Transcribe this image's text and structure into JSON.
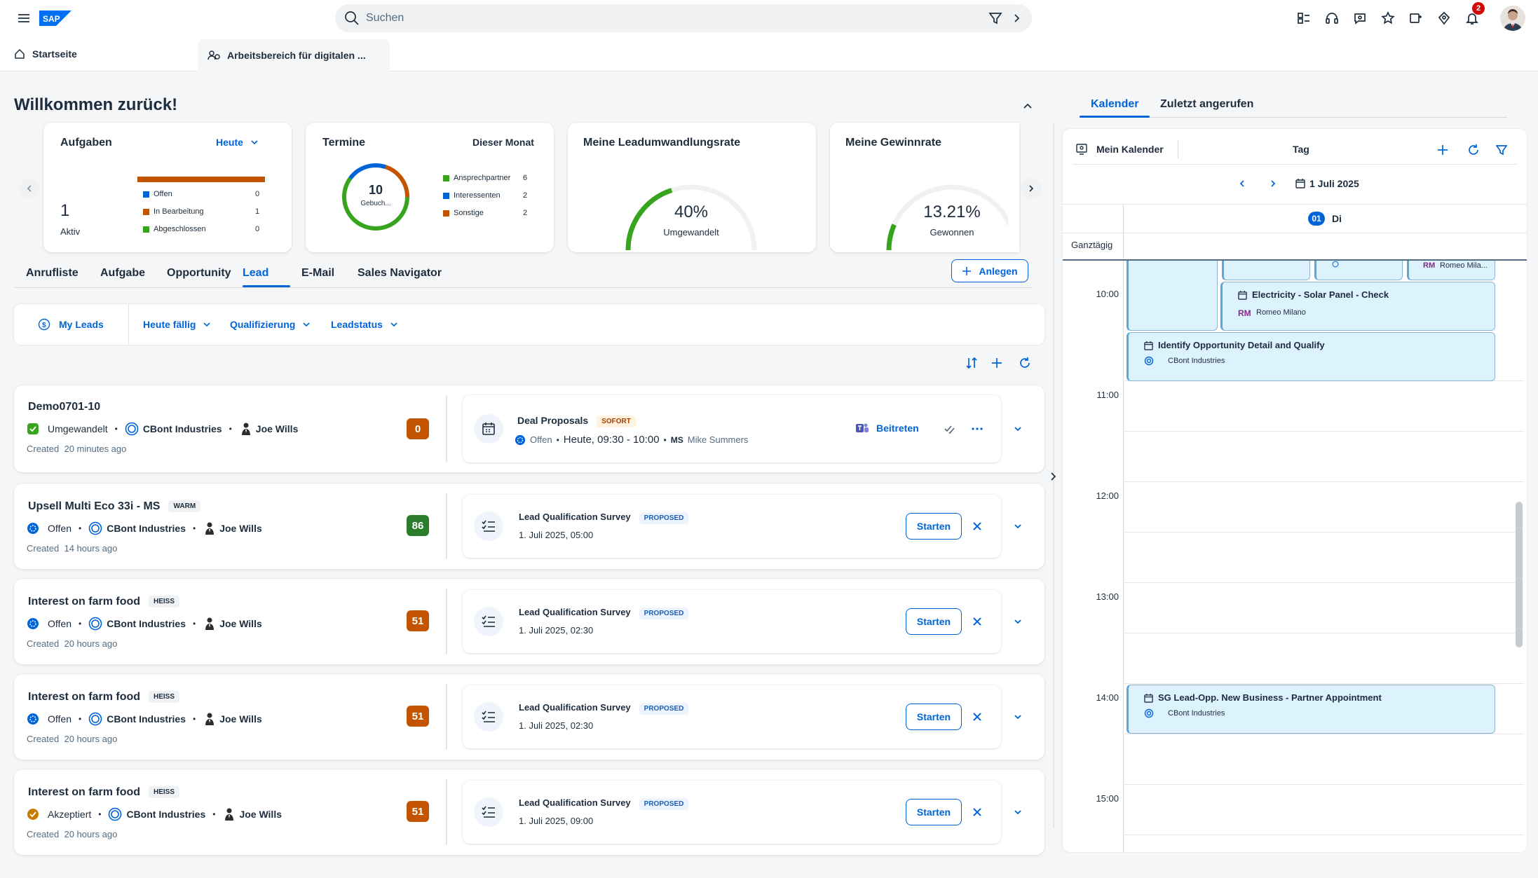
{
  "shell": {
    "logo": "SAP",
    "search_placeholder": "Suchen",
    "notification_count": "2"
  },
  "tabs": [
    {
      "label": "Startseite"
    },
    {
      "label": "Arbeitsbereich für digitalen ..."
    }
  ],
  "welcome": "Willkommen zurück!",
  "cards": {
    "aufgaben": {
      "title": "Aufgaben",
      "period": "Heute",
      "count": "1",
      "count_label": "Aktiv",
      "legend": [
        {
          "label": "Offen",
          "value": "0",
          "color": "#0064d9"
        },
        {
          "label": "In Bearbeitung",
          "value": "1",
          "color": "#c35500"
        },
        {
          "label": "Abgeschlossen",
          "value": "0",
          "color": "#36a41d"
        }
      ]
    },
    "termine": {
      "title": "Termine",
      "period": "Dieser Monat",
      "total": "10",
      "total_label": "Gebuch...",
      "legend": [
        {
          "label": "Ansprechpartner",
          "value": "6",
          "color": "#36a41d"
        },
        {
          "label": "Interessenten",
          "value": "2",
          "color": "#0064d9"
        },
        {
          "label": "Sonstige",
          "value": "2",
          "color": "#c35500"
        }
      ]
    },
    "leadrate": {
      "title": "Meine Leadumwandlungsrate",
      "value": "40%",
      "label": "Umgewandelt",
      "fraction": 0.4
    },
    "winrate": {
      "title": "Meine Gewinnrate",
      "value": "13.21%",
      "label": "Gewonnen",
      "fraction": 0.1321
    }
  },
  "nav_tabs": [
    "Anrufliste",
    "Aufgabe",
    "Opportunity",
    "Lead",
    "E-Mail",
    "Sales Navigator"
  ],
  "create_label": "Anlegen",
  "filters": {
    "my_leads": "My Leads",
    "items": [
      "Heute fällig",
      "Qualifizierung",
      "Leadstatus"
    ]
  },
  "leads": [
    {
      "title": "Demo0701-10",
      "tag": "",
      "status": "Umgewandelt",
      "account": "CBont Industries",
      "owner": "Joe Wills",
      "created_label": "Created",
      "created": "20 minutes ago",
      "score": "0",
      "activity": {
        "title": "Deal Proposals",
        "badge": "SOFORT",
        "status": "Offen",
        "time": "Heute, 09:30 - 10:00",
        "initials": "MS",
        "person": "Mike Summers",
        "action": "Beitreten"
      }
    },
    {
      "title": "Upsell Multi Eco 33i - MS",
      "tag": "WARM",
      "status": "Offen",
      "account": "CBont Industries",
      "owner": "Joe Wills",
      "created_label": "Created",
      "created": "14 hours ago",
      "score": "86",
      "activity": {
        "title": "Lead Qualification Survey",
        "badge": "PROPOSED",
        "date": "1. Juli 2025, 05:00",
        "action": "Starten"
      }
    },
    {
      "title": "Interest on farm food",
      "tag": "HEISS",
      "status": "Offen",
      "account": "CBont Industries",
      "owner": "Joe Wills",
      "created_label": "Created",
      "created": "20 hours ago",
      "score": "51",
      "activity": {
        "title": "Lead Qualification Survey",
        "badge": "PROPOSED",
        "date": "1. Juli 2025, 02:30",
        "action": "Starten"
      }
    },
    {
      "title": "Interest on farm food",
      "tag": "HEISS",
      "status": "Offen",
      "account": "CBont Industries",
      "owner": "Joe Wills",
      "created_label": "Created",
      "created": "20 hours ago",
      "score": "51",
      "activity": {
        "title": "Lead Qualification Survey",
        "badge": "PROPOSED",
        "date": "1. Juli 2025, 02:30",
        "action": "Starten"
      }
    },
    {
      "title": "Interest on farm food",
      "tag": "HEISS",
      "status": "Akzeptiert",
      "account": "CBont Industries",
      "owner": "Joe Wills",
      "created_label": "Created",
      "created": "20 hours ago",
      "score": "51",
      "activity": {
        "title": "Lead Qualification Survey",
        "badge": "PROPOSED",
        "date": "1. Juli 2025, 09:00",
        "action": "Starten"
      }
    }
  ],
  "calendar": {
    "tabs": [
      "Kalender",
      "Zuletzt angerufen"
    ],
    "my_calendar": "Mein Kalender",
    "view": "Tag",
    "date": "1 Juli 2025",
    "day_num": "01",
    "day_name": "Di",
    "allday": "Ganztägig",
    "hours": [
      "10:00",
      "11:00",
      "12:00",
      "13:00",
      "14:00",
      "15:00"
    ],
    "events": [
      {
        "title": "Electricity - Solar Panel - Check",
        "initials": "RM",
        "person": "Romeo Milano"
      },
      {
        "title": "Identify Opportunity Detail and Qualify",
        "account": "CBont Industries"
      },
      {
        "title": "SG Lead-Opp. New Business - Partner Appointment",
        "account": "CBont Industries"
      }
    ],
    "top_partial": {
      "initials": "RM",
      "person": "Romeo Mila..."
    }
  }
}
